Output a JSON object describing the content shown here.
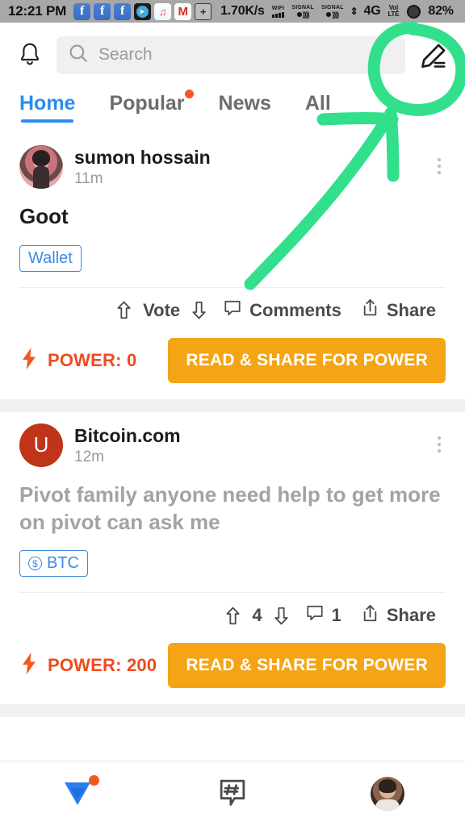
{
  "statusbar": {
    "clock": "12:21 PM",
    "app_icons": [
      "facebook-icon",
      "facebook-icon",
      "facebook-icon",
      "telegram-icon",
      "music-icon",
      "gmail-icon",
      "screenshot-icon"
    ],
    "facebook_glyph": "f",
    "music_glyph": "♫",
    "gmail_glyph": "M",
    "screenshot_glyph": "+",
    "net_speed": "1.70K/s",
    "wifi_label": "WIFI",
    "signal_label_1": "SIGNAL",
    "signal_label_2": "SIGNAL",
    "data_arrows": "⇕",
    "network_type": "4G",
    "volte_top": "Vo|",
    "volte_bottom": "LTE",
    "battery_pct": "82%"
  },
  "header": {
    "bell_icon": "notification-bell-icon",
    "search_placeholder": "Search",
    "search_value": "",
    "search_icon": "search-icon",
    "edit_icon": "edit-pencil-icon"
  },
  "tabs": [
    {
      "label": "Home",
      "active": true,
      "badge": false
    },
    {
      "label": "Popular",
      "active": false,
      "badge": true
    },
    {
      "label": "News",
      "active": false,
      "badge": false
    },
    {
      "label": "All",
      "active": false,
      "badge": false
    }
  ],
  "posts": [
    {
      "author": "sumon hossain",
      "avatar_type": "photo",
      "avatar_letter": "",
      "time": "11m",
      "title": "Goot",
      "title_muted": false,
      "tag": "Wallet",
      "tag_has_coin_icon": false,
      "vote_label": "Vote",
      "comments_label": "Comments",
      "share_label": "Share",
      "power_label": "POWER: 0",
      "cta_label": "READ & SHARE FOR POWER"
    },
    {
      "author": "Bitcoin.com",
      "avatar_type": "letter",
      "avatar_letter": "U",
      "time": "12m",
      "title": "Pivot family anyone need help to get more on pivot can ask me",
      "title_muted": true,
      "tag": "BTC",
      "tag_has_coin_icon": true,
      "coin_glyph": "$",
      "vote_label": "4",
      "comments_label": "1",
      "share_label": "Share",
      "power_label": "POWER: 200",
      "cta_label": "READ & SHARE FOR POWER"
    }
  ],
  "bottom_nav": [
    {
      "icon": "pivot-logo-icon",
      "badge": true
    },
    {
      "icon": "hashtag-bubble-icon",
      "badge": false
    },
    {
      "icon": "profile-avatar-icon",
      "badge": false
    }
  ],
  "annotation": {
    "type": "hand-drawn-highlight",
    "color": "#32e08c",
    "target": "edit-pencil-icon"
  },
  "colors": {
    "accent_blue": "#2a8cf0",
    "tag_blue": "#3f8ae0",
    "cta_orange": "#f5a416",
    "power_orange": "#f04a1e",
    "badge_orange": "#f4581c",
    "annotation_green": "#32e08c",
    "statusbar_gray": "#a8a8a8"
  }
}
